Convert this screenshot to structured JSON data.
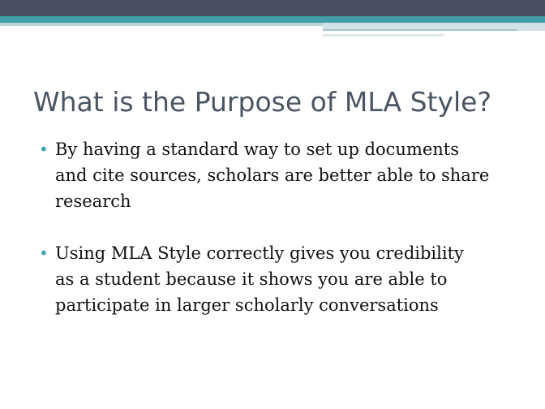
{
  "slide": {
    "title": "What is the Purpose of MLA Style?",
    "bullet_glyph": "•",
    "bullets": [
      {
        "lines": [
          "By having a standard way to set up documents",
          "and cite sources, scholars are better able to share",
          "research"
        ]
      },
      {
        "lines": [
          "Using MLA Style correctly gives you credibility",
          "as a student because it shows you are able to",
          "participate in larger scholarly conversations"
        ]
      }
    ]
  },
  "theme": {
    "header_dark": "#4a4f63",
    "header_teal": "#3f9ea8",
    "header_light": "#b9d3d9",
    "title_color": "#4a5563",
    "bullet_color": "#3fa6b0",
    "text_color": "#111111"
  }
}
